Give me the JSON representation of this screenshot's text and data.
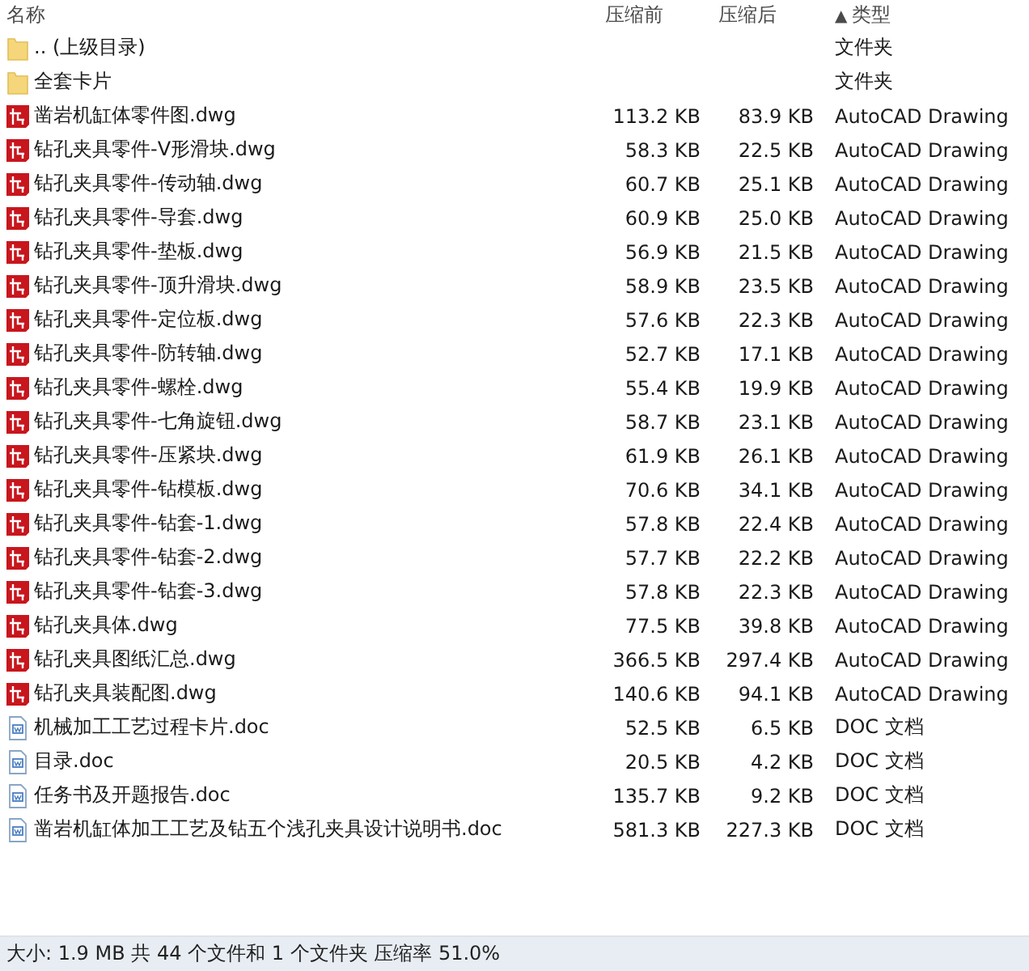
{
  "columns": [
    {
      "label": "名称",
      "sorted": false
    },
    {
      "label": "压缩前",
      "sorted": false
    },
    {
      "label": "压缩后",
      "sorted": false
    },
    {
      "label": "类型",
      "sorted": true,
      "sort_arrow": "▲"
    }
  ],
  "rows": [
    {
      "kind": "folder",
      "name": ".. (上级目录)",
      "type": "文件夹"
    },
    {
      "kind": "folder",
      "name": "全套卡片",
      "type": "文件夹"
    },
    {
      "kind": "dwg",
      "name": "凿岩机缸体零件图.dwg",
      "before": "113.2 KB",
      "after": "83.9 KB",
      "type": "AutoCAD Drawing"
    },
    {
      "kind": "dwg",
      "name": "钻孔夹具零件-V形滑块.dwg",
      "before": "58.3 KB",
      "after": "22.5 KB",
      "type": "AutoCAD Drawing"
    },
    {
      "kind": "dwg",
      "name": "钻孔夹具零件-传动轴.dwg",
      "before": "60.7 KB",
      "after": "25.1 KB",
      "type": "AutoCAD Drawing"
    },
    {
      "kind": "dwg",
      "name": "钻孔夹具零件-导套.dwg",
      "before": "60.9 KB",
      "after": "25.0 KB",
      "type": "AutoCAD Drawing"
    },
    {
      "kind": "dwg",
      "name": "钻孔夹具零件-垫板.dwg",
      "before": "56.9 KB",
      "after": "21.5 KB",
      "type": "AutoCAD Drawing"
    },
    {
      "kind": "dwg",
      "name": "钻孔夹具零件-顶升滑块.dwg",
      "before": "58.9 KB",
      "after": "23.5 KB",
      "type": "AutoCAD Drawing"
    },
    {
      "kind": "dwg",
      "name": "钻孔夹具零件-定位板.dwg",
      "before": "57.6 KB",
      "after": "22.3 KB",
      "type": "AutoCAD Drawing"
    },
    {
      "kind": "dwg",
      "name": "钻孔夹具零件-防转轴.dwg",
      "before": "52.7 KB",
      "after": "17.1 KB",
      "type": "AutoCAD Drawing"
    },
    {
      "kind": "dwg",
      "name": "钻孔夹具零件-螺栓.dwg",
      "before": "55.4 KB",
      "after": "19.9 KB",
      "type": "AutoCAD Drawing"
    },
    {
      "kind": "dwg",
      "name": "钻孔夹具零件-七角旋钮.dwg",
      "before": "58.7 KB",
      "after": "23.1 KB",
      "type": "AutoCAD Drawing"
    },
    {
      "kind": "dwg",
      "name": "钻孔夹具零件-压紧块.dwg",
      "before": "61.9 KB",
      "after": "26.1 KB",
      "type": "AutoCAD Drawing"
    },
    {
      "kind": "dwg",
      "name": "钻孔夹具零件-钻模板.dwg",
      "before": "70.6 KB",
      "after": "34.1 KB",
      "type": "AutoCAD Drawing"
    },
    {
      "kind": "dwg",
      "name": "钻孔夹具零件-钻套-1.dwg",
      "before": "57.8 KB",
      "after": "22.4 KB",
      "type": "AutoCAD Drawing"
    },
    {
      "kind": "dwg",
      "name": "钻孔夹具零件-钻套-2.dwg",
      "before": "57.7 KB",
      "after": "22.2 KB",
      "type": "AutoCAD Drawing"
    },
    {
      "kind": "dwg",
      "name": "钻孔夹具零件-钻套-3.dwg",
      "before": "57.8 KB",
      "after": "22.3 KB",
      "type": "AutoCAD Drawing"
    },
    {
      "kind": "dwg",
      "name": "钻孔夹具体.dwg",
      "before": "77.5 KB",
      "after": "39.8 KB",
      "type": "AutoCAD Drawing"
    },
    {
      "kind": "dwg",
      "name": "钻孔夹具图纸汇总.dwg",
      "before": "366.5 KB",
      "after": "297.4 KB",
      "type": "AutoCAD Drawing"
    },
    {
      "kind": "dwg",
      "name": "钻孔夹具装配图.dwg",
      "before": "140.6 KB",
      "after": "94.1 KB",
      "type": "AutoCAD Drawing"
    },
    {
      "kind": "doc",
      "name": "机械加工工艺过程卡片.doc",
      "before": "52.5 KB",
      "after": "6.5 KB",
      "type": "DOC 文档"
    },
    {
      "kind": "doc",
      "name": "目录.doc",
      "before": "20.5 KB",
      "after": "4.2 KB",
      "type": "DOC 文档"
    },
    {
      "kind": "doc",
      "name": "任务书及开题报告.doc",
      "before": "135.7 KB",
      "after": "9.2 KB",
      "type": "DOC 文档"
    },
    {
      "kind": "doc",
      "name": "凿岩机缸体加工工艺及钻五个浅孔夹具设计说明书.doc",
      "before": "581.3 KB",
      "after": "227.3 KB",
      "type": "DOC 文档"
    }
  ],
  "status_bar": "大小: 1.9 MB 共 44 个文件和 1 个文件夹 压缩率 51.0%"
}
